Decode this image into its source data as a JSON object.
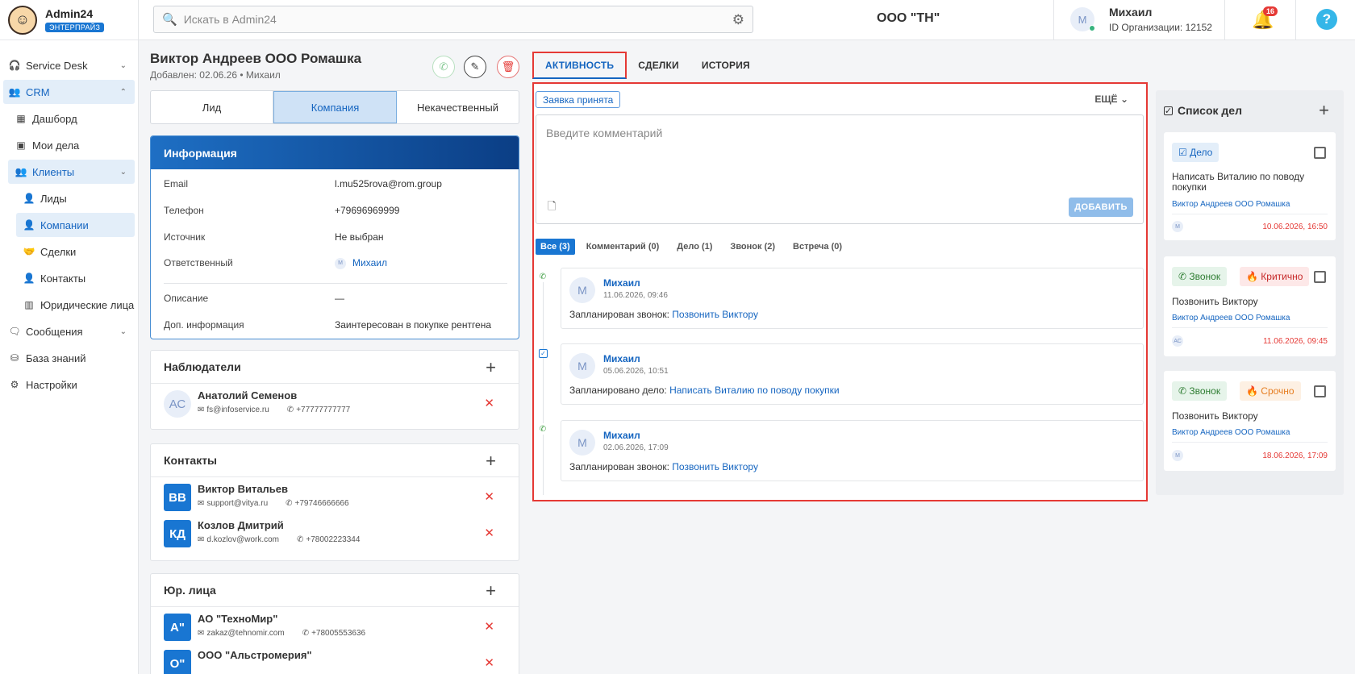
{
  "brand": {
    "name": "Admin24",
    "badge": "ЭНТЕРПРАЙЗ"
  },
  "sidebar": {
    "items": [
      {
        "label": "Service Desk"
      },
      {
        "label": "CRM"
      },
      {
        "label": "Дашборд"
      },
      {
        "label": "Мои дела"
      },
      {
        "label": "Клиенты"
      },
      {
        "label": "Лиды"
      },
      {
        "label": "Компании"
      },
      {
        "label": "Сделки"
      },
      {
        "label": "Контакты"
      },
      {
        "label": "Юридические лица"
      },
      {
        "label": "Сообщения"
      },
      {
        "label": "База знаний"
      },
      {
        "label": "Настройки"
      }
    ]
  },
  "topbar": {
    "search_placeholder": "Искать в Admin24",
    "org_title": "ООО \"ТН\"",
    "user": {
      "initial": "М",
      "name": "Михаил",
      "org": "ID Организации: 12152"
    },
    "notifications": "16"
  },
  "contact": {
    "title": "Виктор Андреев ООО Ромашка",
    "subtitle": "Добавлен: 02.06.26 • Михаил",
    "segments": [
      "Лид",
      "Компания",
      "Некачественный"
    ]
  },
  "info": {
    "title": "Информация",
    "rows": [
      {
        "label": "Email",
        "value": "l.mu525rova@rom.group"
      },
      {
        "label": "Телефон",
        "value": "+79696969999"
      },
      {
        "label": "Источник",
        "value": "Не выбран"
      },
      {
        "label": "Ответственный",
        "value": "Михаил",
        "avatar": "М"
      },
      {
        "label": "Описание",
        "value": "—"
      },
      {
        "label": "Доп. информация",
        "value": "Заинтересован в покупке рентгена"
      }
    ]
  },
  "watchers": {
    "title": "Наблюдатели",
    "items": [
      {
        "initials": "АС",
        "name": "Анатолий Семенов",
        "email": "fs@infoservice.ru",
        "phone": "+77777777777"
      }
    ]
  },
  "contacts": {
    "title": "Контакты",
    "items": [
      {
        "initials": "ВВ",
        "name": "Виктор Витальев",
        "email": "support@vitya.ru",
        "phone": "+79746666666"
      },
      {
        "initials": "КД",
        "name": "Козлов Дмитрий",
        "email": "d.kozlov@work.com",
        "phone": "+78002223344"
      }
    ]
  },
  "legal": {
    "title": "Юр. лица",
    "items": [
      {
        "initials": "А\"",
        "name": "АО \"ТехноМир\"",
        "email": "zakaz@tehnomir.com",
        "phone": "+78005553636"
      },
      {
        "initials": "О\"",
        "name": "ООО \"Альстромерия\""
      }
    ]
  },
  "tabs": [
    "АКТИВНОСТЬ",
    "СДЕЛКИ",
    "ИСТОРИЯ"
  ],
  "activity": {
    "status": "Заявка принята",
    "more": "ЕЩЁ",
    "comment_placeholder": "Введите комментарий",
    "add_button": "ДОБАВИТЬ",
    "filters": [
      "Все (3)",
      "Комментарий (0)",
      "Дело (1)",
      "Звонок (2)",
      "Встреча (0)"
    ],
    "entries": [
      {
        "type": "call",
        "initial": "М",
        "author": "Михаил",
        "date": "11.06.2026, 09:46",
        "prefix": "Запланирован звонок: ",
        "link": "Позвонить Виктору"
      },
      {
        "type": "task",
        "initial": "М",
        "author": "Михаил",
        "date": "05.06.2026, 10:51",
        "prefix": "Запланировано дело: ",
        "link": "Написать Виталию по поводу покупки"
      },
      {
        "type": "call",
        "initial": "М",
        "author": "Михаил",
        "date": "02.06.2026, 17:09",
        "prefix": "Запланирован звонок: ",
        "link": "Позвонить Виктору"
      }
    ]
  },
  "todo": {
    "title": "Список дел",
    "cards": [
      {
        "chips": [
          "Дело"
        ],
        "title": "Написать Виталию по поводу покупки",
        "link": "Виктор Андреев ООО Ромашка",
        "avatar": "М",
        "date": "10.06.2026, 16:50"
      },
      {
        "chips": [
          "Звонок",
          "Критично"
        ],
        "title": "Позвонить Виктору",
        "link": "Виктор Андреев ООО Ромашка",
        "avatar": "АС",
        "date": "11.06.2026, 09:45"
      },
      {
        "chips": [
          "Звонок",
          "Срочно"
        ],
        "title": "Позвонить Виктору",
        "link": "Виктор Андреев ООО Ромашка",
        "avatar": "М",
        "date": "18.06.2026, 17:09"
      }
    ]
  },
  "colors": {
    "accent": "#1976d2",
    "highlight": "#e53935",
    "success": "#43a047"
  }
}
